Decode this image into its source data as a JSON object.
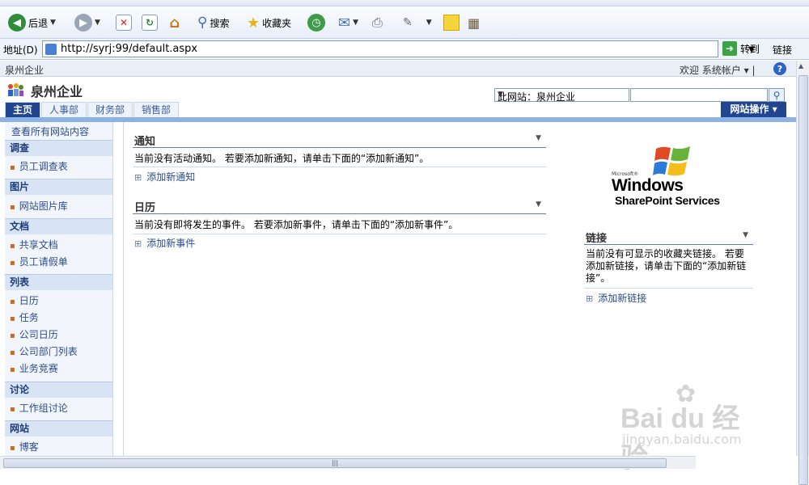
{
  "browser": {
    "toolbar": {
      "back_label": "后退",
      "search_label": "搜索",
      "favorites_label": "收藏夹"
    },
    "address": {
      "label": "地址(D)",
      "url": "http://syrj:99/default.aspx",
      "go_label": "转到",
      "links_label": "链接"
    }
  },
  "sp_header": {
    "site_crumb": "泉州企业",
    "welcome": "欢迎 系统帐户 ▾ |",
    "help": "?"
  },
  "site": {
    "title": "泉州企业",
    "search_scope": "此网站：泉州企业",
    "site_actions": "网站操作 ▾"
  },
  "tabs": [
    {
      "label": "主页",
      "active": true
    },
    {
      "label": "人事部"
    },
    {
      "label": "财务部"
    },
    {
      "label": "销售部"
    }
  ],
  "leftnav": {
    "view_all": "查看所有网站内容",
    "groups": [
      {
        "title": "调查",
        "items": [
          "员工调查表"
        ]
      },
      {
        "title": "图片",
        "items": [
          "网站图片库"
        ]
      },
      {
        "title": "文档",
        "items": [
          "共享文档",
          "员工请假单"
        ]
      },
      {
        "title": "列表",
        "items": [
          "日历",
          "任务",
          "公司日历",
          "公司部门列表",
          "业务竞赛"
        ]
      },
      {
        "title": "讨论",
        "items": [
          "工作组讨论"
        ]
      },
      {
        "title": "网站",
        "items": [
          "博客"
        ]
      }
    ]
  },
  "webparts": {
    "announcements": {
      "title": "通知",
      "body": "当前没有活动通知。 若要添加新通知，请单击下面的“添加新通知”。",
      "add": "添加新通知"
    },
    "calendar": {
      "title": "日历",
      "body": "当前没有即将发生的事件。 若要添加新事件，请单击下面的“添加新事件”。",
      "add": "添加新事件"
    },
    "links": {
      "title": "链接",
      "body": "当前没有可显示的收藏夹链接。 若要添加新链接，请单击下面的“添加新链接”。",
      "add": "添加新链接"
    }
  },
  "logo": {
    "microsoft": "Microsoft®",
    "windows": "Windows",
    "product": "SharePoint Services"
  },
  "watermark": {
    "main": "Bai du 经验",
    "url": "jingyan.baidu.com"
  },
  "colors": {
    "nav_blue": "#21468f",
    "link_blue": "#2a4c8e",
    "bullet_orange": "#d06a1b"
  }
}
